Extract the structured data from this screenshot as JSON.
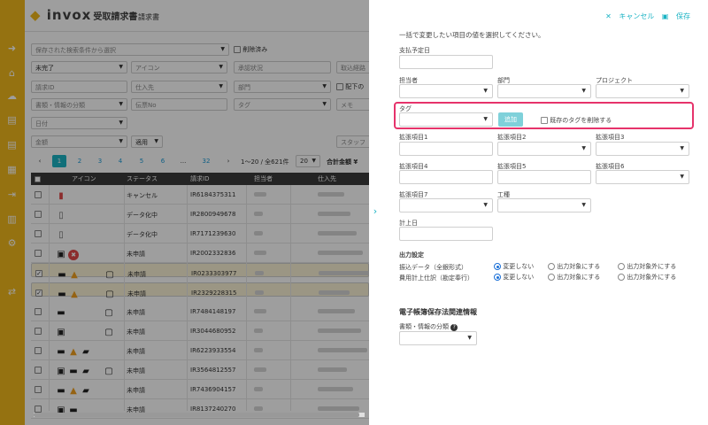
{
  "app": {
    "logo_text": "invox",
    "logo_sub": "受取請求書",
    "tab": "請求書"
  },
  "rail_icons": [
    "arrow-circle-icon",
    "home-icon",
    "cloud-upload-icon",
    "file-icon",
    "file-icon",
    "building-icon",
    "export-icon",
    "chart-icon",
    "gear-icon",
    "transfer-icon"
  ],
  "filters": {
    "saved_search_placeholder": "保存された検索条件から選択",
    "show_deleted": "削除済み",
    "status_value": "未完了",
    "icon_placeholder": "アイコン",
    "approval_placeholder": "承認状況",
    "import_route_placeholder": "取込経路",
    "invoice_id_placeholder": "請求ID",
    "vendor_placeholder": "仕入先",
    "department_placeholder": "部門",
    "distribution_label": "配下の",
    "doc_type_placeholder": "書類・情報の分類",
    "slip_no_placeholder": "伝票No",
    "tag_placeholder": "タグ",
    "memo_placeholder": "メモ",
    "date_placeholder": "日付",
    "amount_placeholder": "金額",
    "tax_placeholder": "適用",
    "staff_placeholder": "スタッフ"
  },
  "pagination": {
    "pages": [
      "1",
      "2",
      "3",
      "4",
      "5",
      "6",
      "...",
      "32"
    ],
    "range": "1〜20 / 全621件",
    "per_page": "20",
    "total_label": "合計金額 ¥"
  },
  "table": {
    "headers": [
      "アイコン",
      "ステータス",
      "請求ID",
      "担当者",
      "仕入先"
    ],
    "rows": [
      {
        "status": "キャンセル",
        "id": "IR6184375311",
        "selected": false,
        "checked": false
      },
      {
        "status": "データ化中",
        "id": "IR2800949678",
        "selected": false,
        "checked": false
      },
      {
        "status": "データ化中",
        "id": "IR7171239630",
        "selected": false,
        "checked": false
      },
      {
        "status": "未申請",
        "id": "IR2002332836",
        "selected": false,
        "checked": false
      },
      {
        "status": "未申請",
        "id": "IR0233303977",
        "selected": true,
        "checked": true
      },
      {
        "status": "未申請",
        "id": "IR2329228315",
        "selected": true,
        "checked": true
      },
      {
        "status": "未申請",
        "id": "IR7484148197",
        "selected": false,
        "checked": false
      },
      {
        "status": "未申請",
        "id": "IR3044680952",
        "selected": false,
        "checked": false
      },
      {
        "status": "未申請",
        "id": "IR6223933554",
        "selected": false,
        "checked": false
      },
      {
        "status": "未申請",
        "id": "IR3564812557",
        "selected": false,
        "checked": false
      },
      {
        "status": "未申請",
        "id": "IR7436904157",
        "selected": false,
        "checked": false
      },
      {
        "status": "未申請",
        "id": "IR8137240270",
        "selected": false,
        "checked": false
      }
    ]
  },
  "panel": {
    "cancel": "キャンセル",
    "save": "保存",
    "instruction": "一括で変更したい項目の値を選択してください。",
    "payment_date": "支払予定日",
    "person": "担当者",
    "department": "部門",
    "project": "プロジェクト",
    "tag": "タグ",
    "add": "追加",
    "delete_tags": "既存のタグを削除する",
    "ext1": "拡張項目1",
    "ext2": "拡張項目2",
    "ext3": "拡張項目3",
    "ext4": "拡張項目4",
    "ext5": "拡張項目5",
    "ext6": "拡張項目6",
    "ext7": "拡張項目7",
    "construction": "工種",
    "posting_date": "計上日",
    "output_settings": "出力設定",
    "transfer_data": "振込データ（全銀形式）",
    "expense_journal": "費用計上仕訳（勘定奉行）",
    "opt_no_change": "変更しない",
    "opt_include": "出力対象にする",
    "opt_exclude": "出力対象外にする",
    "ebook_section": "電子帳簿保存法関連情報",
    "doc_type": "書類・情報の分類",
    "help_icon": "?"
  }
}
